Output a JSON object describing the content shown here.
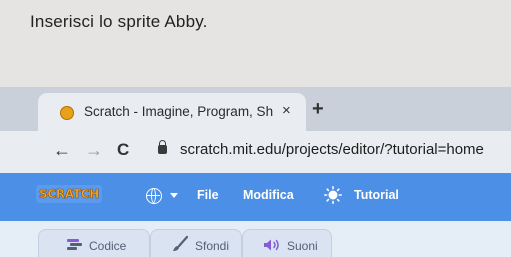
{
  "instruction": "Inserisci lo sprite Abby.",
  "browser": {
    "tab": {
      "title": "Scratch - Imagine, Program, Sh",
      "close_glyph": "×",
      "favicon": "scratch-favicon-icon"
    },
    "new_tab_glyph": "+",
    "nav": {
      "back_glyph": "←",
      "forward_glyph": "→",
      "reload_glyph": "C"
    },
    "url": "scratch.mit.edu/projects/editor/?tutorial=home"
  },
  "scratch": {
    "logo_text": "SCRATCH",
    "menu": {
      "language_icon": "globe-icon",
      "file": "File",
      "edit": "Modifica",
      "tutorial": "Tutorial"
    },
    "editor_tabs": [
      {
        "label": "Codice",
        "icon": "code-icon"
      },
      {
        "label": "Sfondi",
        "icon": "brush-icon"
      },
      {
        "label": "Suoni",
        "icon": "speaker-icon"
      }
    ]
  },
  "colors": {
    "menubar": "#4c8fe6",
    "logo": "#f7a828",
    "accent_purple": "#855cd6",
    "background": "#e6e4e2"
  }
}
